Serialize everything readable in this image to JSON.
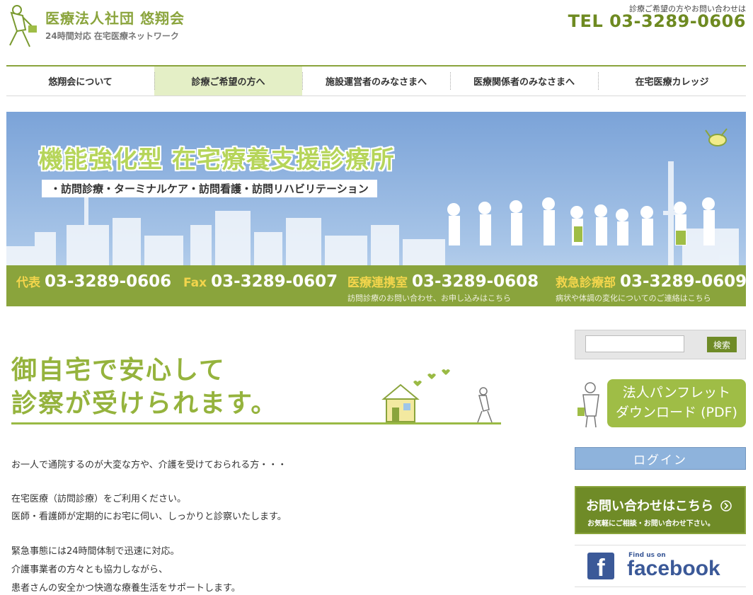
{
  "header": {
    "logo_title": "医療法人社団 悠翔会",
    "logo_subtitle": "24時間対応 在宅医療ネットワーク",
    "tel_note": "診療ご希望の方やお問い合わせは",
    "tel_number": "TEL 03-3289-0606"
  },
  "nav": {
    "items": [
      {
        "label": "悠翔会について"
      },
      {
        "label": "診療ご希望の方へ"
      },
      {
        "label": "施設運営者のみなさまへ"
      },
      {
        "label": "医療関係者のみなさまへ"
      },
      {
        "label": "在宅医療カレッジ"
      }
    ]
  },
  "banner": {
    "title": "機能強化型 在宅療養支援診療所",
    "subtitle": "・訪問診療・ターミナルケア・訪問看護・訪問リハビリテーション",
    "phones": [
      {
        "label": "代表",
        "number": "03-3289-0606",
        "note": ""
      },
      {
        "label": "Fax",
        "number": "03-3289-0607",
        "note": ""
      },
      {
        "label": "医療連携室",
        "number": "03-3289-0608",
        "note": "訪問診療のお問い合わせ、お申し込みはこちら"
      },
      {
        "label": "救急診療部",
        "number": "03-3289-0609",
        "note": "病状や体調の変化についてのご連絡はこちら"
      }
    ]
  },
  "hero": {
    "line1": "御自宅で安心して",
    "line2": "診察が受けられます。"
  },
  "body": {
    "p1": "お一人で通院するのが大変な方や、介護を受けておられる方・・・",
    "p2a": "在宅医療（訪問診療）をご利用ください。",
    "p2b": "医師・看護師が定期的にお宅に伺い、しっかりと診察いたします。",
    "p3a": "緊急事態には24時間体制で迅速に対応。",
    "p3b": "介護事業者の方々とも協力しながら、",
    "p3c": "患者さんの安全かつ快適な療養生活をサポートします。"
  },
  "sidebar": {
    "search_value": "",
    "search_button": "検索",
    "pamphlet_line1": "法人パンフレット",
    "pamphlet_line2": "ダウンロード (PDF)",
    "login": "ログイン",
    "contact_title": "お問い合わせはこちら",
    "contact_sub": "お気軽にご相談・お問い合わせ下さい。",
    "fb_find": "Find us on",
    "fb_word": "facebook",
    "fb_letter": "f"
  },
  "colors": {
    "brand_green": "#8aa43c",
    "dark_green": "#6f8b27",
    "banner_blue": "#7ba3d8",
    "login_blue": "#8eb3dc",
    "facebook_blue": "#3b5998"
  },
  "icons": [
    "walking-doctor-icon",
    "bird-icon",
    "house-icon",
    "chevron-right-icon",
    "facebook-f-icon"
  ]
}
